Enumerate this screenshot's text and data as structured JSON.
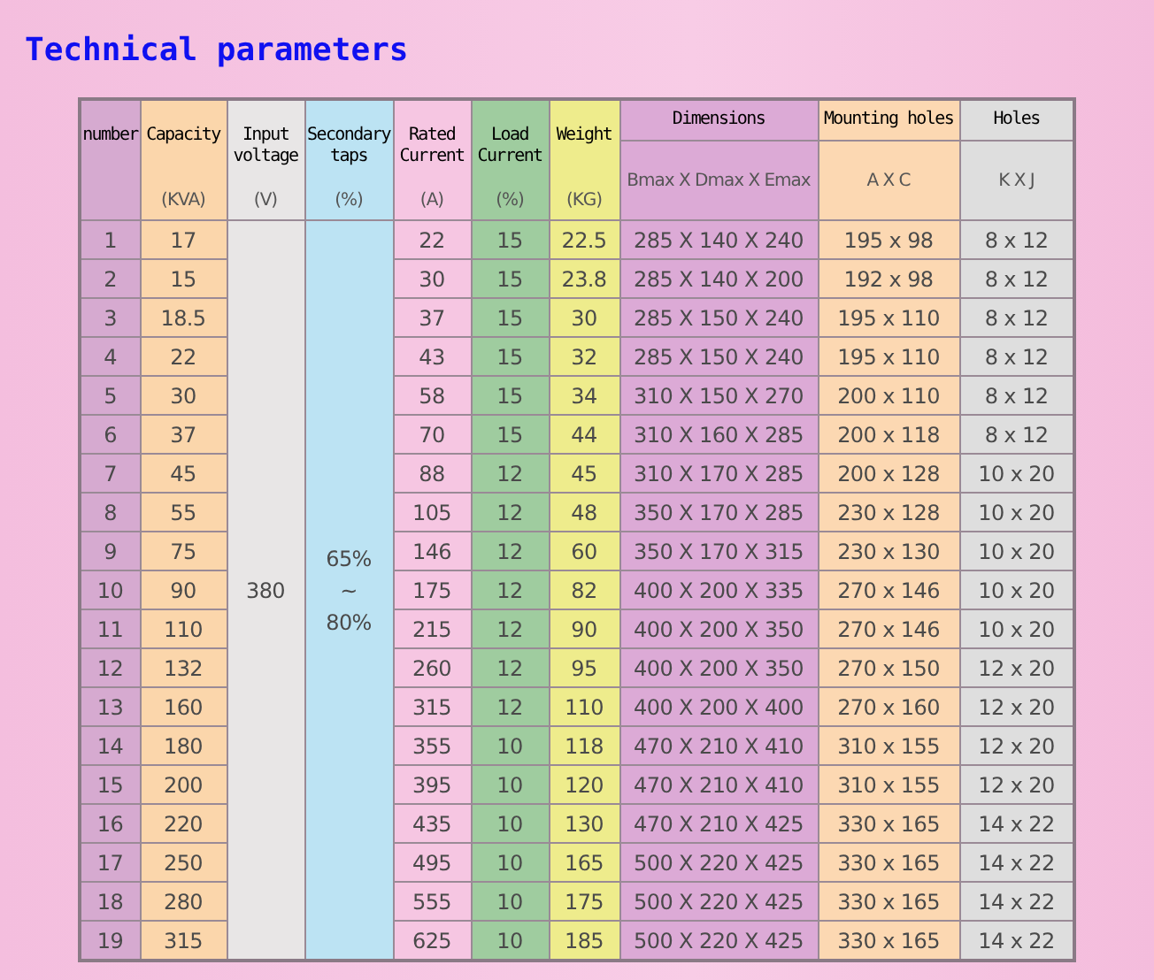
{
  "title": "Technical parameters",
  "table": {
    "columns": [
      {
        "kind": "plain",
        "title": "number"
      },
      {
        "kind": "plain",
        "title": "Capacity",
        "unit": "(KVA)"
      },
      {
        "kind": "merged",
        "title": "Input voltage",
        "unit": "(V)"
      },
      {
        "kind": "merged",
        "title": "Secondary taps",
        "unit": "(%)"
      },
      {
        "kind": "plain",
        "title": "Rated Current",
        "unit": "(A)"
      },
      {
        "kind": "plain",
        "title": "Load Current",
        "unit": "(%)"
      },
      {
        "kind": "plain",
        "title": "Weight",
        "unit": "(KG)"
      },
      {
        "kind": "split",
        "title": "Dimensions",
        "unit": "Bmax X Dmax X Emax"
      },
      {
        "kind": "split",
        "title": "Mounting holes",
        "unit": "A X C"
      },
      {
        "kind": "split",
        "title": "Holes",
        "unit": "K X J"
      }
    ],
    "rows": [
      [
        "1",
        "17",
        {
          "text": "380",
          "rowspan": 19
        },
        {
          "text": "65%\n~\n80%",
          "rowspan": 19
        },
        "22",
        "15",
        "22.5",
        "285 X 140 X 240",
        "195 x 98",
        "8 x 12"
      ],
      [
        "2",
        "15",
        "30",
        "15",
        "23.8",
        "285 X 140 X 200",
        "192 x 98",
        "8 x 12"
      ],
      [
        "3",
        "18.5",
        "37",
        "15",
        "30",
        "285 X 150 X 240",
        "195 x 110",
        "8 x 12"
      ],
      [
        "4",
        "22",
        "43",
        "15",
        "32",
        "285 X 150 X 240",
        "195 x 110",
        "8 x 12"
      ],
      [
        "5",
        "30",
        "58",
        "15",
        "34",
        "310 X 150 X 270",
        "200 x 110",
        "8 x 12"
      ],
      [
        "6",
        "37",
        "70",
        "15",
        "44",
        "310 X 160 X 285",
        "200 x 118",
        "8 x 12"
      ],
      [
        "7",
        "45",
        "88",
        "12",
        "45",
        "310 X 170 X 285",
        "200 x 128",
        "10 x 20"
      ],
      [
        "8",
        "55",
        "105",
        "12",
        "48",
        "350 X 170 X 285",
        "230 x 128",
        "10 x 20"
      ],
      [
        "9",
        "75",
        "146",
        "12",
        "60",
        "350 X 170 X 315",
        "230 x 130",
        "10 x 20"
      ],
      [
        "10",
        "90",
        "175",
        "12",
        "82",
        "400 X 200 X 335",
        "270 x 146",
        "10 x 20"
      ],
      [
        "11",
        "110",
        "215",
        "12",
        "90",
        "400 X 200 X 350",
        "270 x 146",
        "10 x 20"
      ],
      [
        "12",
        "132",
        "260",
        "12",
        "95",
        "400 X 200 X 350",
        "270 x 150",
        "12 x 20"
      ],
      [
        "13",
        "160",
        "315",
        "12",
        "110",
        "400 X 200 X 400",
        "270 x 160",
        "12 x 20"
      ],
      [
        "14",
        "180",
        "355",
        "10",
        "118",
        "470 X 210 X 410",
        "310 x 155",
        "12 x 20"
      ],
      [
        "15",
        "200",
        "395",
        "10",
        "120",
        "470 X 210 X 410",
        "310 x 155",
        "12 x 20"
      ],
      [
        "16",
        "220",
        "435",
        "10",
        "130",
        "470 X 210 X 425",
        "330 x 165",
        "14 x 22"
      ],
      [
        "17",
        "250",
        "495",
        "10",
        "165",
        "500 X 220 X 425",
        "330 x 165",
        "14 x 22"
      ],
      [
        "18",
        "280",
        "555",
        "10",
        "175",
        "500 X 220 X 425",
        "330 x 165",
        "14 x 22"
      ],
      [
        "19",
        "315",
        "625",
        "10",
        "185",
        "500 X 220 X 425",
        "330 x 165",
        "14 x 22"
      ]
    ]
  }
}
